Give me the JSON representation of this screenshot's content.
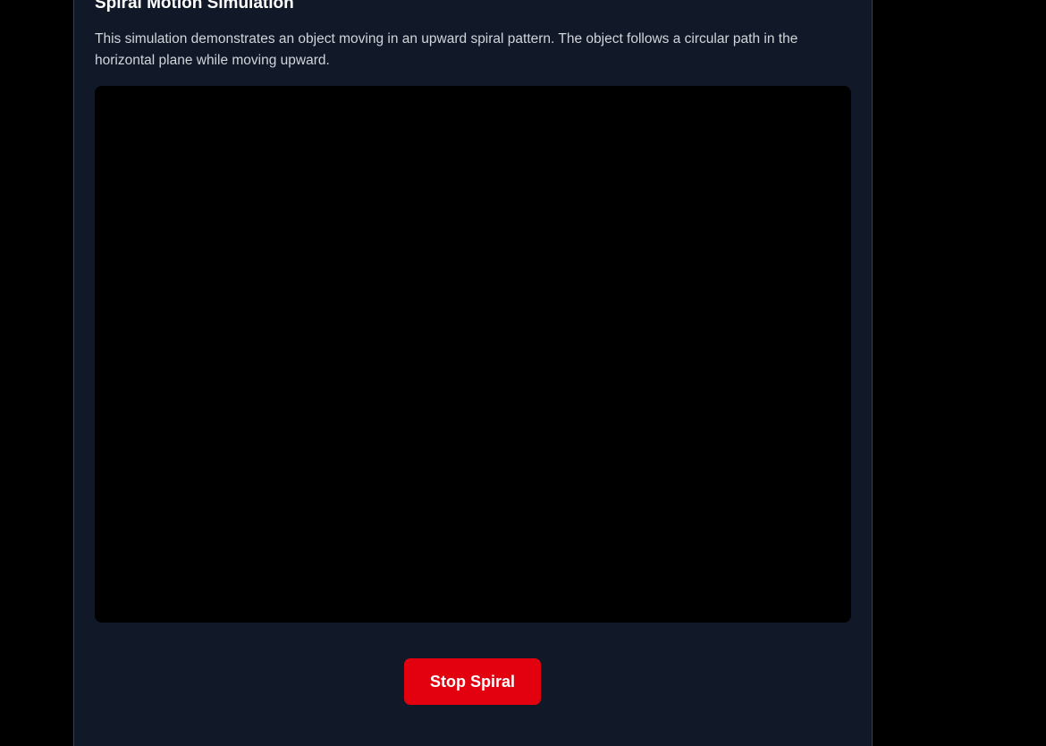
{
  "header": {
    "title": "Spiral Motion Simulation",
    "description": "This simulation demonstrates an object moving in an upward spiral pattern. The object follows a circular path in the horizontal plane while moving upward."
  },
  "controls": {
    "stop_label": "Stop Spiral",
    "stop_color": "#e3000f"
  },
  "theme": {
    "page_background": "#000000",
    "panel_background": "#111827",
    "canvas_background": "#000000"
  }
}
